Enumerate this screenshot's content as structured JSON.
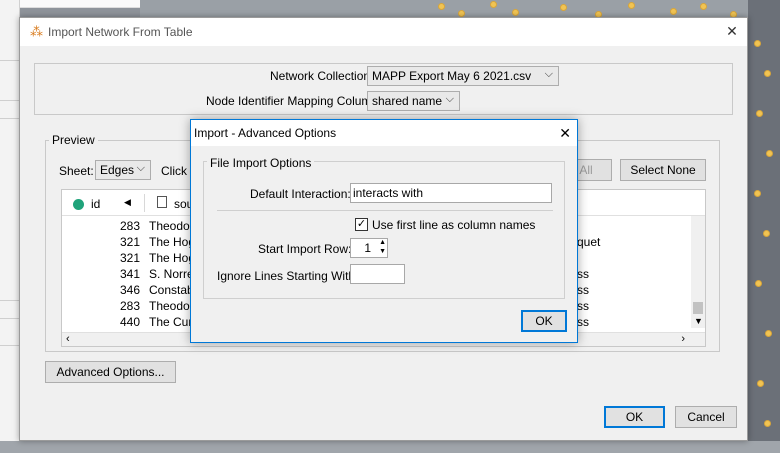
{
  "window": {
    "title": "Import Network From Table",
    "close_glyph": "✕",
    "app_icon": "⁂"
  },
  "top": {
    "network_collection_label": "Network Collection:",
    "network_collection_value": "MAPP Export May 6 2021.csv",
    "mapping_label": "Node Identifier Mapping Column:",
    "mapping_value": "shared name"
  },
  "preview": {
    "title": "Preview",
    "sheet_label": "Sheet:",
    "sheet_value": "Edges",
    "click_text": "Click o",
    "select_all_label": "All",
    "select_none_label": "Select None",
    "columns": [
      {
        "name": "id",
        "icon": "green-dot-icon"
      },
      {
        "name": "sou",
        "icon": "document-icon"
      }
    ],
    "rows": [
      {
        "id": "283",
        "source": "Theodora",
        "extra": ""
      },
      {
        "id": "321",
        "source": "The Hoga",
        "extra": "quet"
      },
      {
        "id": "321",
        "source": "The Hoga",
        "extra": ""
      },
      {
        "id": "341",
        "source": "S. Norrel",
        "extra": "ss"
      },
      {
        "id": "346",
        "source": "Constabl",
        "extra": "ss"
      },
      {
        "id": "283",
        "source": "Theodora",
        "extra": "ss"
      },
      {
        "id": "440",
        "source": "The Curv",
        "extra": "ss"
      }
    ],
    "first_row_partial": "Theodora"
  },
  "advanced_button": "Advanced Options...",
  "ok_label": "OK",
  "cancel_label": "Cancel",
  "modal": {
    "title": "Import - Advanced Options",
    "group_title": "File Import Options",
    "default_interaction_label": "Default Interaction:",
    "default_interaction_value": "interacts with",
    "use_first_line_label": "Use first line as column names",
    "use_first_line_checked": true,
    "start_row_label": "Start Import Row:",
    "start_row_value": "1",
    "ignore_lines_label": "Ignore Lines Starting With:",
    "ignore_lines_value": "",
    "ok_label": "OK"
  }
}
